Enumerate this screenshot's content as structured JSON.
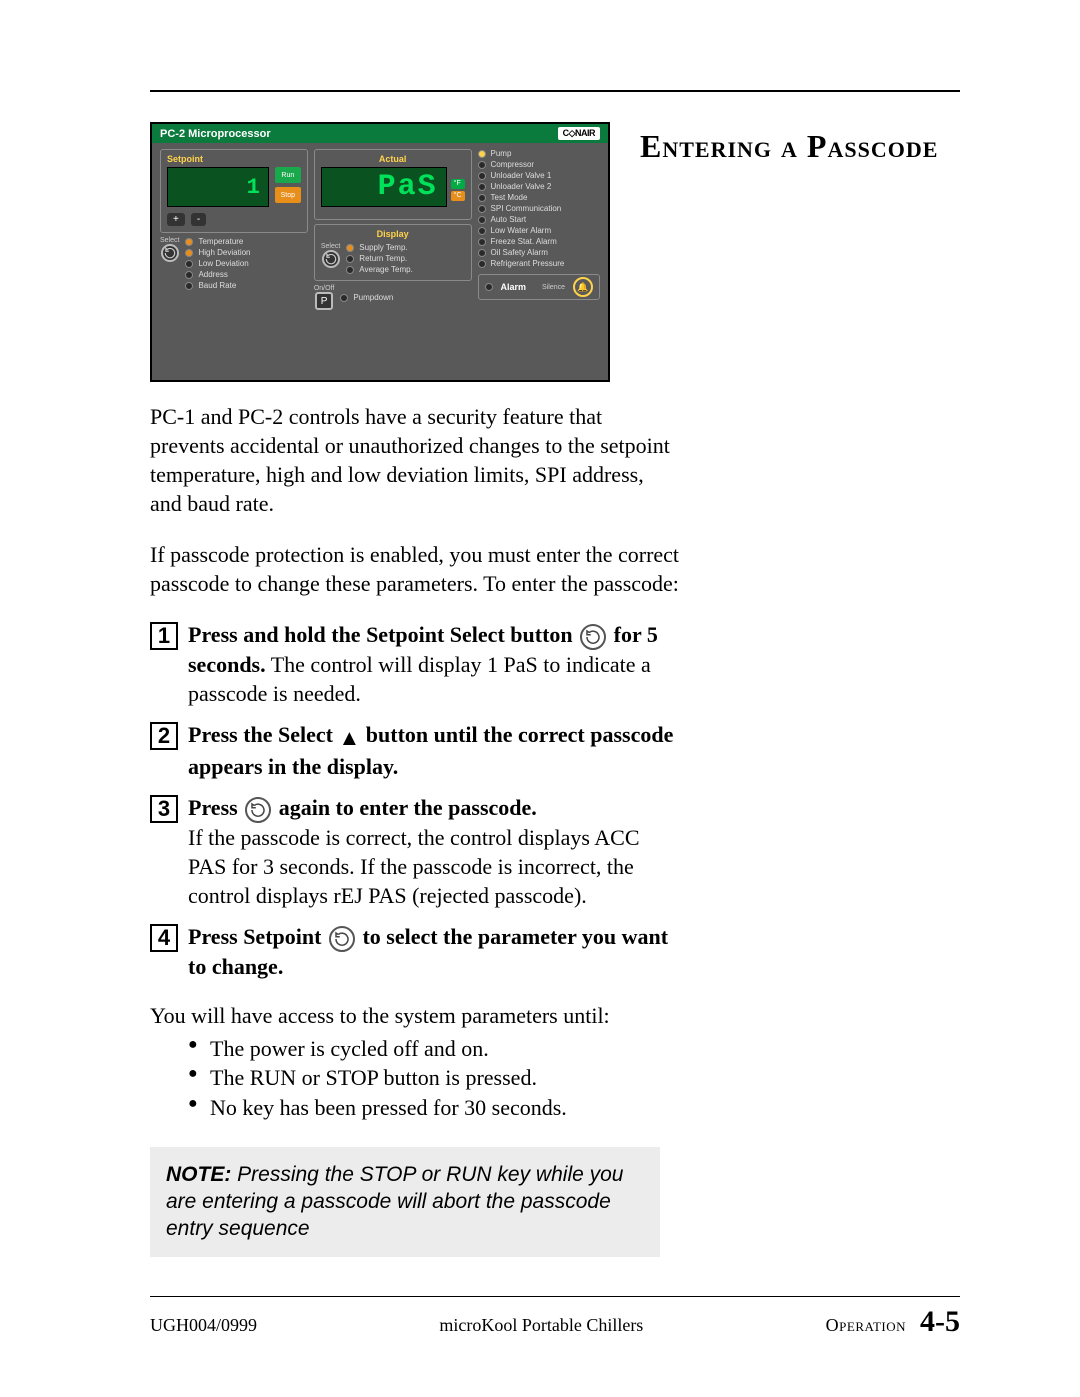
{
  "title": "Entering a Passcode",
  "device": {
    "header": "PC-2 Microprocessor",
    "brand": "C◇NAIR",
    "setpoint": {
      "label": "Setpoint",
      "value": "1"
    },
    "buttons": {
      "plus": "+",
      "minus": "-",
      "run": "Run",
      "stop": "Stop",
      "select_label": "Select",
      "onoff_label": "On/Off"
    },
    "actual": {
      "label": "Actual",
      "value": "PaS",
      "unit_f": "°F",
      "unit_c": "°C"
    },
    "display": {
      "label": "Display"
    },
    "setpoint_leds": [
      "Temperature",
      "High Deviation",
      "Low Deviation",
      "Address",
      "Baud Rate"
    ],
    "display_leds": [
      "Supply Temp.",
      "Return Temp.",
      "Average Temp."
    ],
    "pumpdown_label": "Pumpdown",
    "status_leds": [
      "Pump",
      "Compressor",
      "Unloader Valve 1",
      "Unloader Valve 2",
      "Test Mode",
      "SPI Communication",
      "Auto Start",
      "Low Water Alarm",
      "Freeze Stat. Alarm",
      "Oil Safety Alarm",
      "Refrigerant Pressure"
    ],
    "alarm_label": "Alarm",
    "silence_label": "Silence",
    "p_button": "P"
  },
  "paragraphs": {
    "p1": "PC-1 and PC-2 controls have a security feature that prevents accidental or unauthorized changes to the setpoint temperature, high and low deviation limits, SPI address, and baud rate.",
    "p2": "If passcode protection is enabled, you must enter the correct passcode to change these parameters. To enter the passcode:"
  },
  "steps": {
    "s1_a": "Press and hold the Setpoint Select button",
    "s1_b": "for 5 seconds.",
    "s1_c": " The control will display 1 PaS to indicate a passcode is needed.",
    "s2_a": "Press the Select ",
    "s2_b": " button until the correct passcode appears in the display.",
    "s3_a": "Press ",
    "s3_b": " again to enter the passcode.",
    "s3_c": "If the passcode is correct, the control displays ACC PAS for 3 seconds. If the passcode is incorrect, the control displays rEJ PAS (rejected passcode).",
    "s4_a": "Press Setpoint ",
    "s4_b": " to select the parameter you want to change."
  },
  "access_intro": "You will have access to the system parameters until:",
  "access_bullets": [
    "The power is cycled off and on.",
    "The RUN or STOP button is pressed.",
    "No key has been pressed for 30 seconds."
  ],
  "note_label": "NOTE:",
  "note": " Pressing the STOP or RUN key while you are entering a passcode will abort the passcode entry sequence",
  "footer": {
    "left": "UGH004/0999",
    "center": "microKool Portable Chillers",
    "section": "Operation",
    "page": "4-5"
  }
}
